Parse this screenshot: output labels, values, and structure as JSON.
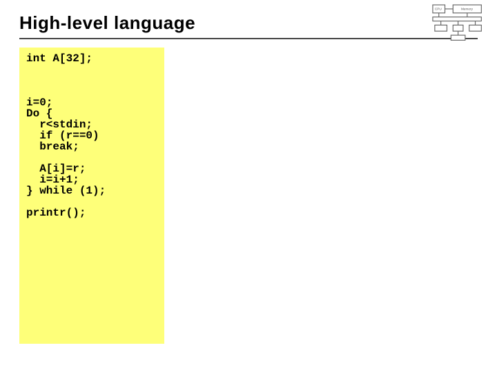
{
  "slide": {
    "title": "High-level language",
    "code": "int A[32];\n\n\n\ni=0;\nDo {\n  r<stdin;\n  if (r==0)\n  break;\n\n  A[i]=r;\n  i=i+1;\n} while (1);\n\nprintr();"
  },
  "diagram": {
    "name": "computer-diagram",
    "labels": {
      "memory": "Memory",
      "cpu": "CPU"
    }
  }
}
